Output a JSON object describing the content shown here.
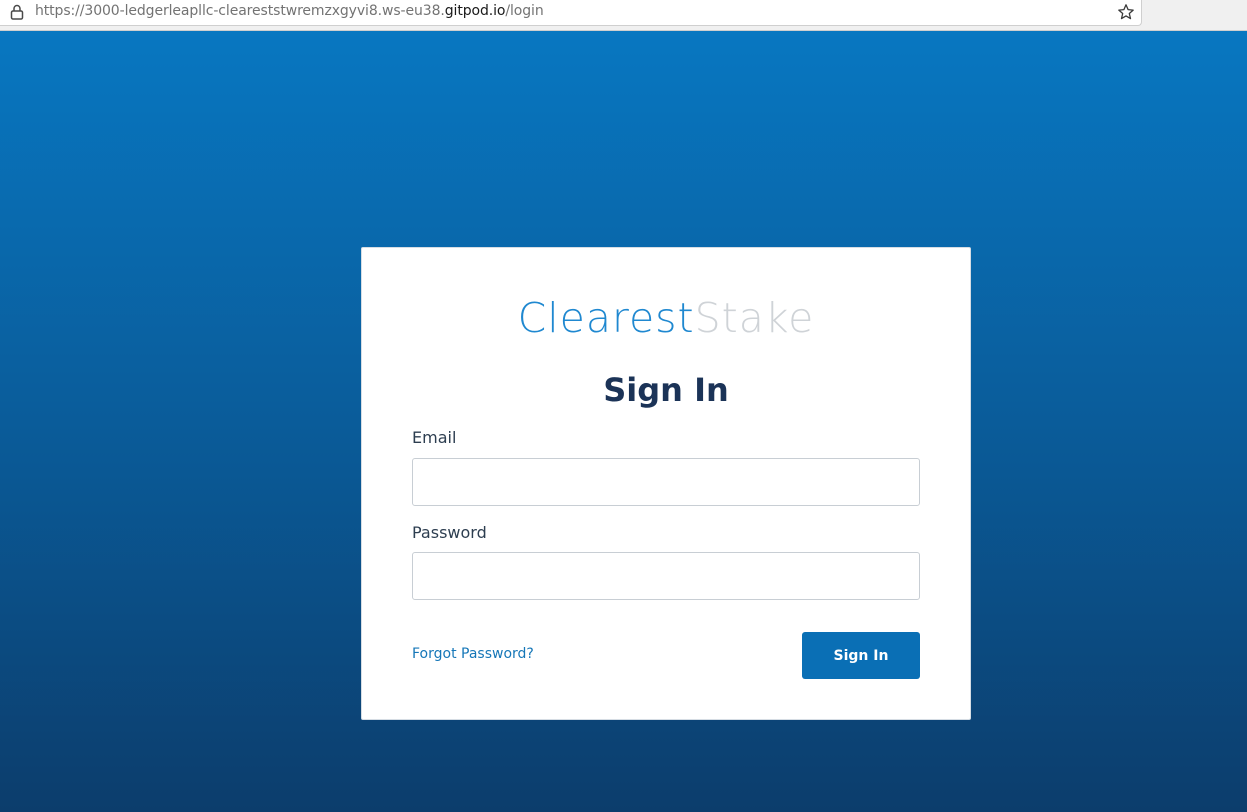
{
  "browser": {
    "url_prefix": "https://3000-ledgerleapllc-cleareststwremzxgyvi8.ws-eu38.",
    "url_host": "gitpod.io",
    "url_path": "/login"
  },
  "logo": {
    "part1": "Clearest",
    "part2": "Stake"
  },
  "signin": {
    "title": "Sign In",
    "email_label": "Email",
    "email_value": "",
    "password_label": "Password",
    "password_value": "",
    "forgot_label": "Forgot Password?",
    "button_label": "Sign In"
  },
  "colors": {
    "brand_blue": "#1f88d0",
    "brand_gray": "#cfd3d7",
    "button": "#0a6fb5",
    "title": "#1b3357"
  },
  "icons": [
    "lock-icon",
    "star-icon"
  ]
}
